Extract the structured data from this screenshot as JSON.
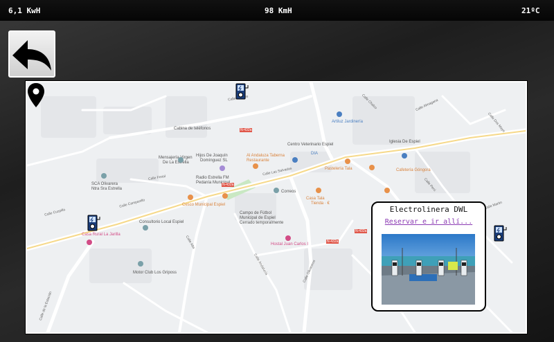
{
  "status_bar": {
    "energy": "6,1 KwH",
    "speed": "98 KmH",
    "temperature": "21ºC"
  },
  "back_button": {
    "icon": "back-arrow-icon"
  },
  "map": {
    "places": [
      {
        "id": "cabina",
        "text": "Cabina de teléfonos"
      },
      {
        "id": "hijos",
        "text": "Hijos De Joaquín"
      },
      {
        "id": "hijos2",
        "text": "Domínguez SL"
      },
      {
        "id": "mensajeria",
        "text": "Mensajería Virgen"
      },
      {
        "id": "mensajeria2",
        "text": "De La Estrella"
      },
      {
        "id": "radio",
        "text": "Radio Estrella FM"
      },
      {
        "id": "radio2",
        "text": "Pedanía Municipal"
      },
      {
        "id": "centro",
        "text": "Centro Veterinario Espiel"
      },
      {
        "id": "artiluz",
        "text": "Artiluz Jardinería"
      },
      {
        "id": "iglesia",
        "text": "Iglesia De Espiel"
      },
      {
        "id": "dia",
        "text": "DIA"
      },
      {
        "id": "andaluza",
        "text": "Al Andaluza Taberna"
      },
      {
        "id": "andaluza2",
        "text": "Restaurante"
      },
      {
        "id": "pastel",
        "text": "Pastelería Tala"
      },
      {
        "id": "cafeteria",
        "text": "Cafetería Góngora"
      },
      {
        "id": "sca",
        "text": "SCA Olivarera"
      },
      {
        "id": "sca2",
        "text": "Ntra Sra Estrella"
      },
      {
        "id": "correos",
        "text": "Correos"
      },
      {
        "id": "casa",
        "text": "Casa Tala"
      },
      {
        "id": "casa2",
        "text": "Tienda · €"
      },
      {
        "id": "cesco",
        "text": "Cesco Municipal Espiel"
      },
      {
        "id": "campo",
        "text": "Campo de Fútbol"
      },
      {
        "id": "campo2",
        "text": "Municipal de Espiel"
      },
      {
        "id": "campo3",
        "text": "Cerrado temporalmente"
      },
      {
        "id": "consultorio",
        "text": "Consultorio Local Espiel"
      },
      {
        "id": "casarural",
        "text": "Casa Rural La Jarilla"
      },
      {
        "id": "hostal",
        "text": "Hostal Juan Carlos I"
      },
      {
        "id": "motor",
        "text": "Motor Club Los Griposs"
      }
    ],
    "streets": [
      {
        "id": "s1",
        "text": "Calle de Tres"
      },
      {
        "id": "s2",
        "text": "Calle Campanillo"
      },
      {
        "id": "s3",
        "text": "Calle Cuzpilla"
      },
      {
        "id": "s4",
        "text": "Calle Las Salvadas"
      },
      {
        "id": "s5",
        "text": "Calle Perú"
      },
      {
        "id": "s6",
        "text": "Calle Chalco"
      },
      {
        "id": "s7",
        "text": "Calle Almagana"
      },
      {
        "id": "s8",
        "text": "Calle Dos Mayo"
      },
      {
        "id": "s9",
        "text": "Calle de la Estación"
      },
      {
        "id": "s10",
        "text": "Calle Olivareros"
      },
      {
        "id": "s11",
        "text": "Calle Martin"
      },
      {
        "id": "s12",
        "text": "Calle Alta"
      },
      {
        "id": "s13",
        "text": "Calle Ferial"
      },
      {
        "id": "s14",
        "text": "Calle Andalucía"
      }
    ],
    "road_tags": [
      "N-432a",
      "N-432a",
      "N-432a",
      "N-432a"
    ],
    "stations": [
      "ev-charger-icon",
      "ev-charger-icon",
      "ev-charger-icon"
    ],
    "selected_marker": "map-pin-icon"
  },
  "popup": {
    "title": "Electrolinera DWL",
    "link": "Reservar e ir allí..."
  }
}
